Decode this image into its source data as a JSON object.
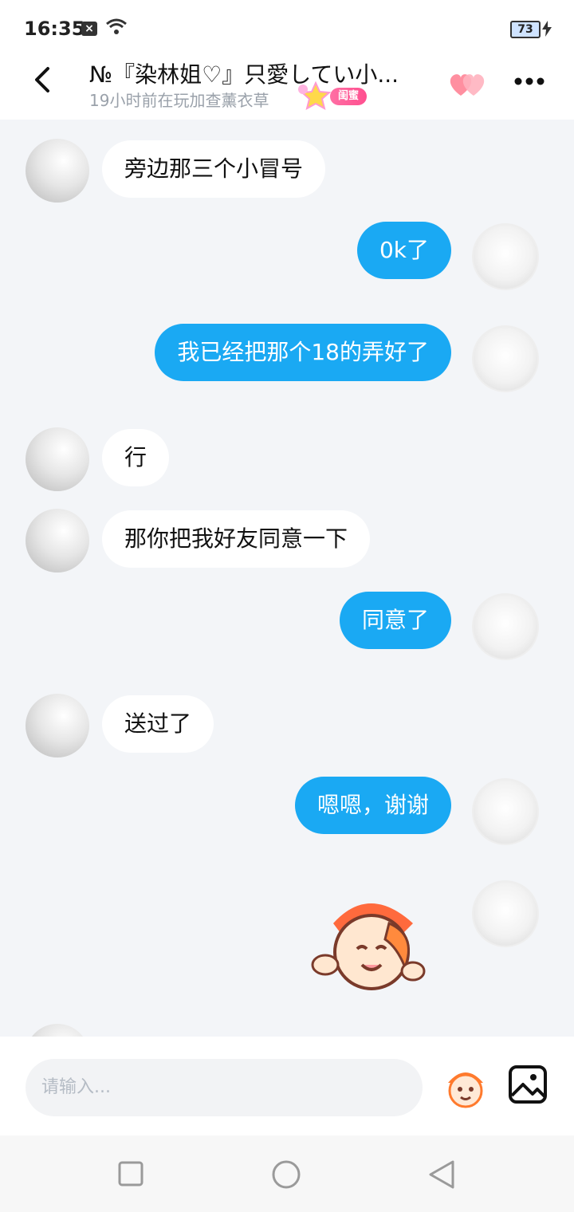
{
  "status_bar": {
    "time": "16:35",
    "battery": "73"
  },
  "header": {
    "title": "№『染林姐♡』只愛してい小...",
    "subtitle": "19小时前在玩加查薰衣草",
    "badge": "闺蜜"
  },
  "messages": [
    {
      "side": "left",
      "text": "旁边那三个小冒号"
    },
    {
      "side": "right",
      "text": "0k了"
    },
    {
      "side": "right",
      "text": "我已经把那个18的弄好了"
    },
    {
      "side": "left",
      "text": "行"
    },
    {
      "side": "left",
      "text": "那你把我好友同意一下"
    },
    {
      "side": "right",
      "text": "同意了"
    },
    {
      "side": "left",
      "text": "送过了"
    },
    {
      "side": "right",
      "text": "嗯嗯，谢谢"
    }
  ],
  "input": {
    "placeholder": "请输入..."
  },
  "icons": {
    "back": "chevron-left-icon",
    "more": "more-dots-icon",
    "emoji": "sticker-icon",
    "image": "image-icon",
    "nav": [
      "square-icon",
      "circle-icon",
      "triangle-back-icon"
    ]
  },
  "colors": {
    "accent": "#1aa9f3",
    "badge": "#ff4f8f"
  }
}
